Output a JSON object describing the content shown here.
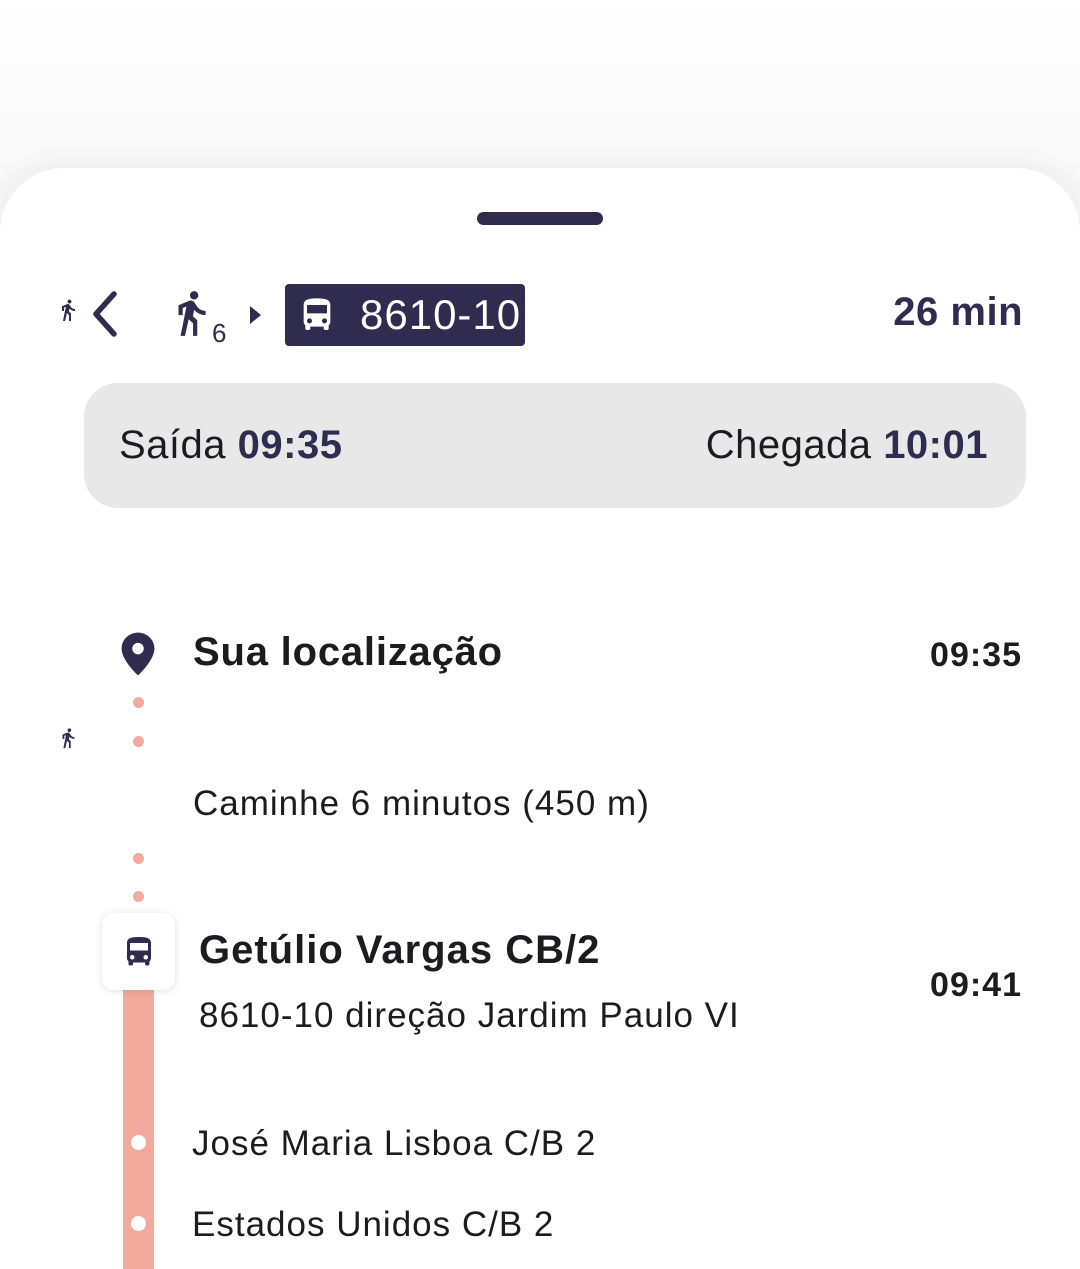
{
  "header": {
    "walk_minutes": "6",
    "route_code": "8610-10",
    "duration": "26 min"
  },
  "times": {
    "departure_label": "Saída",
    "departure_time": "09:35",
    "arrival_label": "Chegada",
    "arrival_time": "10:01"
  },
  "timeline": {
    "origin": {
      "name": "Sua localização",
      "time": "09:35"
    },
    "walk": {
      "text": "Caminhe 6 minutos (450 m)"
    },
    "boarding": {
      "name": "Getúlio Vargas CB/2",
      "subtitle": "8610-10 direção Jardim Paulo VI",
      "time": "09:41"
    },
    "stops": [
      {
        "name": "José Maria Lisboa C/B 2"
      },
      {
        "name": "Estados Unidos C/B 2"
      }
    ]
  },
  "colors": {
    "primary": "#2f2c50",
    "route_line": "#f2aa9c",
    "times_bar_bg": "#e8e8e8"
  },
  "icons": [
    "walk-icon",
    "back-arrow-icon",
    "caret-right-icon",
    "bus-icon",
    "location-pin-icon"
  ]
}
